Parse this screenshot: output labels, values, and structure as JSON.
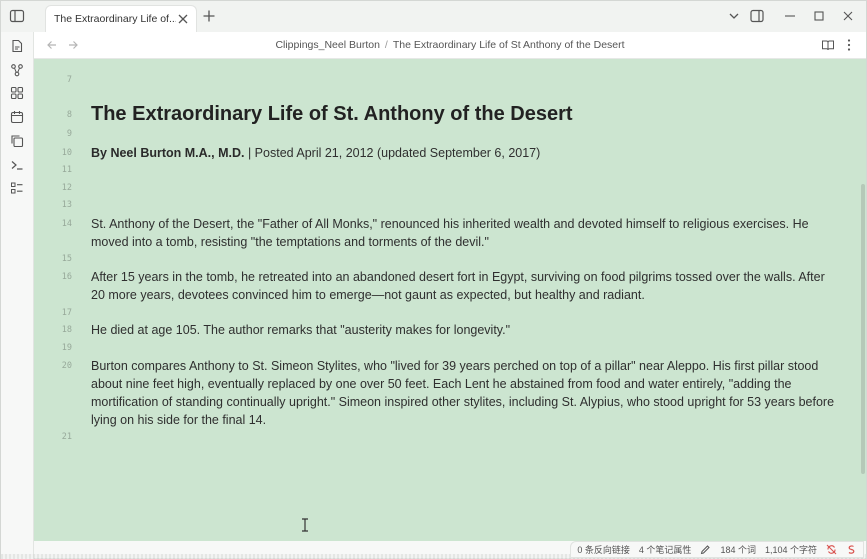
{
  "tab": {
    "title": "The Extraordinary Life of..."
  },
  "breadcrumb": {
    "folder": "Clippings_Neel Burton",
    "separator": "/",
    "file": "The Extraordinary Life of St Anthony of the Desert"
  },
  "editor": {
    "lines": [
      {
        "num": "7",
        "text": ""
      },
      {
        "num": "8",
        "text": "The Extraordinary Life of St. Anthony of the Desert"
      },
      {
        "num": "9",
        "text": ""
      },
      {
        "num": "10",
        "author": "By Neel Burton M.A., M.D.",
        "rest": " | Posted April 21, 2012 (updated September 6, 2017)"
      },
      {
        "num": "11",
        "text": ""
      },
      {
        "num": "12",
        "text": ""
      },
      {
        "num": "13",
        "text": ""
      },
      {
        "num": "14",
        "text": "St. Anthony of the Desert, the \"Father of All Monks,\" renounced his inherited wealth and devoted himself to religious exercises. He moved into a tomb, resisting \"the temptations and torments of the devil.\""
      },
      {
        "num": "15",
        "text": ""
      },
      {
        "num": "16",
        "text": "After 15 years in the tomb, he retreated into an abandoned desert fort in Egypt, surviving on food pilgrims tossed over the walls. After 20 more years, devotees convinced him to emerge—not gaunt as expected, but healthy and radiant."
      },
      {
        "num": "17",
        "text": ""
      },
      {
        "num": "18",
        "text": "He died at age 105. The author remarks that \"austerity makes for longevity.\""
      },
      {
        "num": "19",
        "text": ""
      },
      {
        "num": "20",
        "text": "Burton compares Anthony to St. Simeon Stylites, who \"lived for 39 years perched on top of a pillar\" near Aleppo. His first pillar stood about nine feet high, eventually replaced by one over 50 feet. Each Lent he abstained from food and water entirely, \"adding the mortification of standing continually upright.\" Simeon inspired other stylites, including St. Alypius, who stood upright for 53 years before lying on his side for the final 14."
      },
      {
        "num": "21",
        "text": ""
      }
    ]
  },
  "statusbar": {
    "backlinks": "0 条反向链接",
    "properties": "4 个笔记属性",
    "words": "184 个词",
    "chars": "1,104 个字符"
  },
  "icons": {
    "sidebar_toggle": "sidebar-toggle-icon",
    "tab_close": "close-icon",
    "new_tab": "plus-icon",
    "ribbon": [
      "file-icon",
      "graph-icon",
      "canvas-icon",
      "calendar-icon",
      "copy-icon",
      "terminal-icon",
      "checklist-icon"
    ],
    "nav": [
      "back-arrow-icon",
      "forward-arrow-icon",
      "reading-view-icon",
      "more-options-icon"
    ]
  },
  "colors": {
    "editor_bg": "#cce5d0",
    "sync_icon": "#d9534f"
  }
}
